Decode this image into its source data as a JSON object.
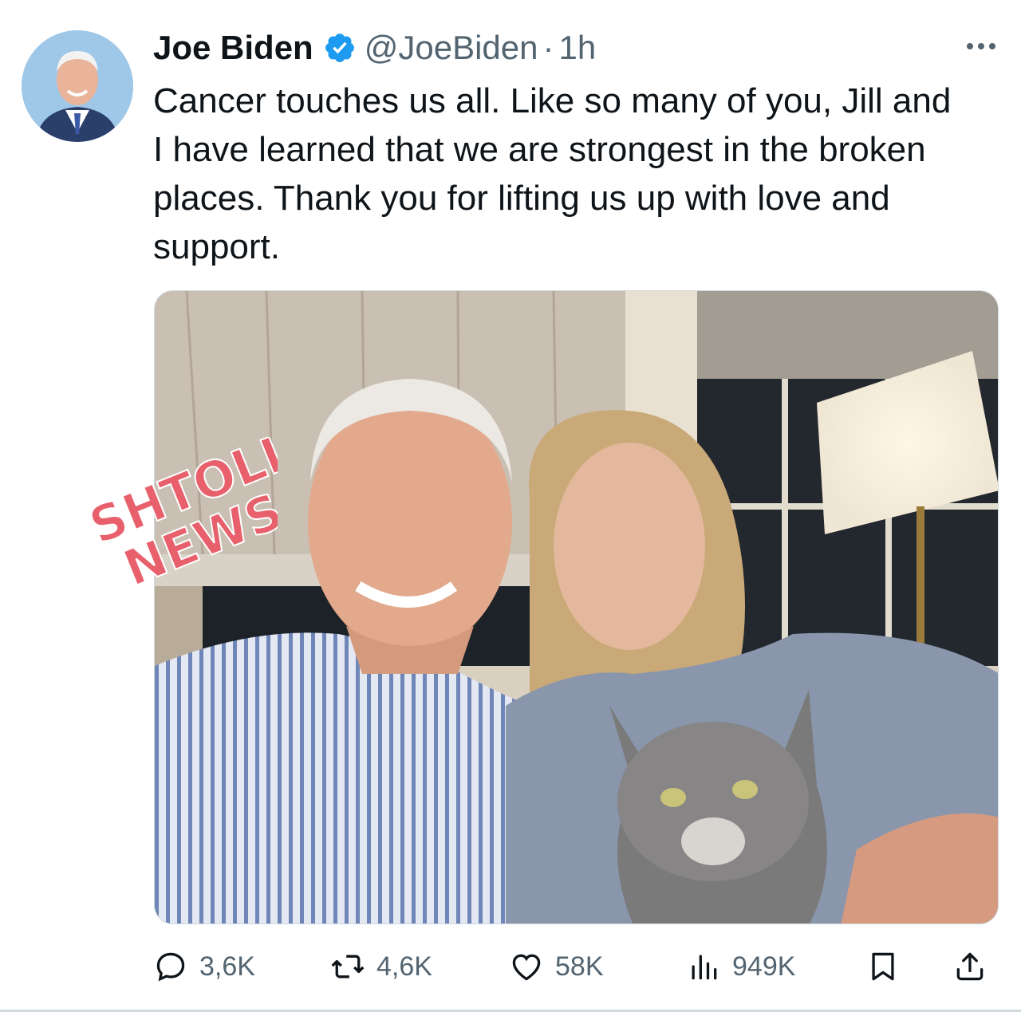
{
  "author": {
    "display_name": "Joe Biden",
    "handle": "@JoeBiden",
    "separator": "·",
    "time": "1h"
  },
  "tweet": {
    "text": "Cancer touches us all. Like so many of you, Jill and I have learned that we are strongest in the broken places. Thank you for lifting us up with love and support."
  },
  "media": {
    "watermark": "SHTOLL NEWS"
  },
  "actions": {
    "replies": "3,6K",
    "reposts": "4,6K",
    "likes": "58K",
    "views": "949K"
  },
  "icons": {
    "verified": "verified-badge-icon",
    "more": "more-options-icon",
    "reply": "reply-icon",
    "repost": "repost-icon",
    "like": "heart-icon",
    "views": "views-chart-icon",
    "bookmark": "bookmark-icon",
    "share": "share-icon"
  },
  "colors": {
    "text": "#0f1419",
    "secondary": "#536471",
    "verified": "#1d9bf0",
    "watermark": "#e8606c"
  }
}
